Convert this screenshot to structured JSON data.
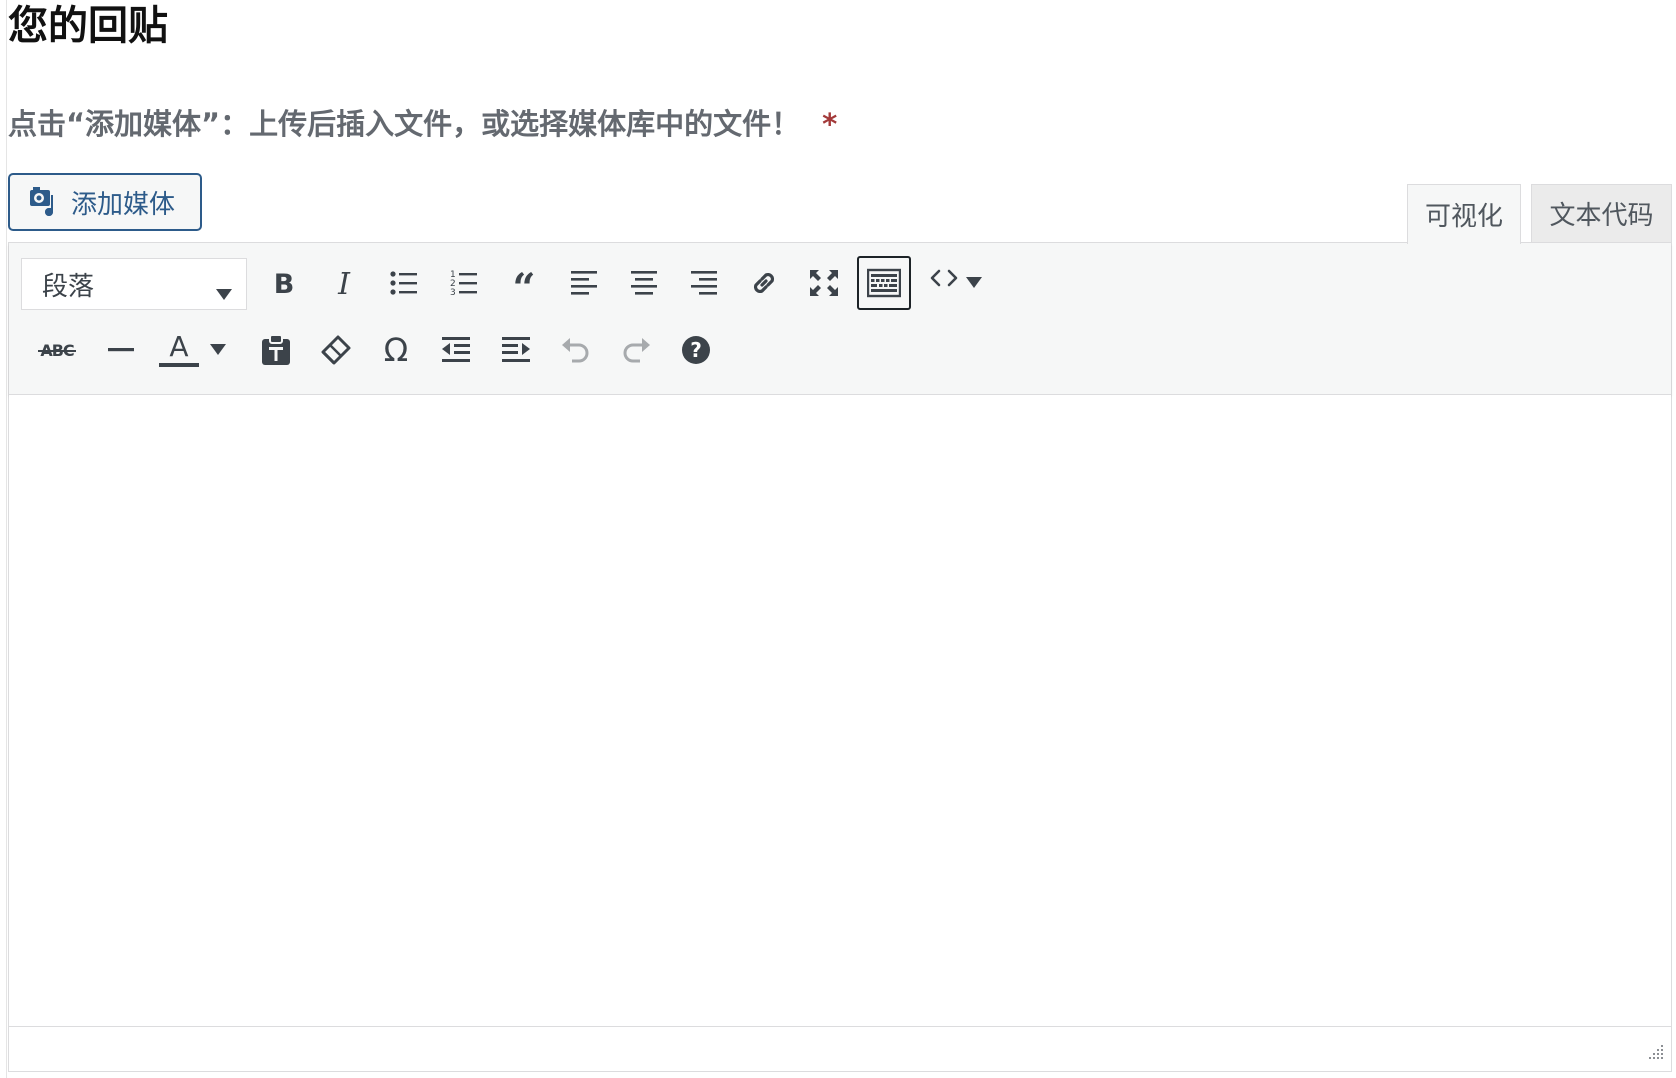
{
  "page_title": "您的回贴",
  "hint": {
    "text": "点击“添加媒体”：上传后插入文件，或选择媒体库中的文件！",
    "required_mark": "*"
  },
  "add_media": {
    "label": "添加媒体",
    "icon": "add-media-icon"
  },
  "tabs": [
    {
      "label": "可视化",
      "active": true
    },
    {
      "label": "文本代码",
      "active": false
    }
  ],
  "toolbar": {
    "format_select": {
      "value": "段落"
    },
    "row1_icons": [
      "bold-icon",
      "italic-icon",
      "bullet-list-icon",
      "numbered-list-icon",
      "blockquote-icon",
      "align-left-icon",
      "align-center-icon",
      "align-right-icon",
      "link-icon",
      "fullscreen-icon",
      "toolbar-toggle-icon",
      "code-icon",
      "dropdown-caret-icon"
    ],
    "row2_icons": [
      "strikethrough-icon",
      "horizontal-rule-icon",
      "text-color-icon",
      "paste-text-icon",
      "clear-formatting-icon",
      "special-character-icon",
      "outdent-icon",
      "indent-icon",
      "undo-icon",
      "redo-icon",
      "help-icon"
    ],
    "strike_label": "ABC",
    "text_color_label": "A",
    "omega_label": "Ω",
    "toggle_active": true
  },
  "colors": {
    "accent": "#2d5b8a",
    "required": "#a33a3a",
    "toolbar_bg": "#f6f7f7",
    "icon": "#3c434a",
    "disabled_icon": "#a7aaad"
  }
}
